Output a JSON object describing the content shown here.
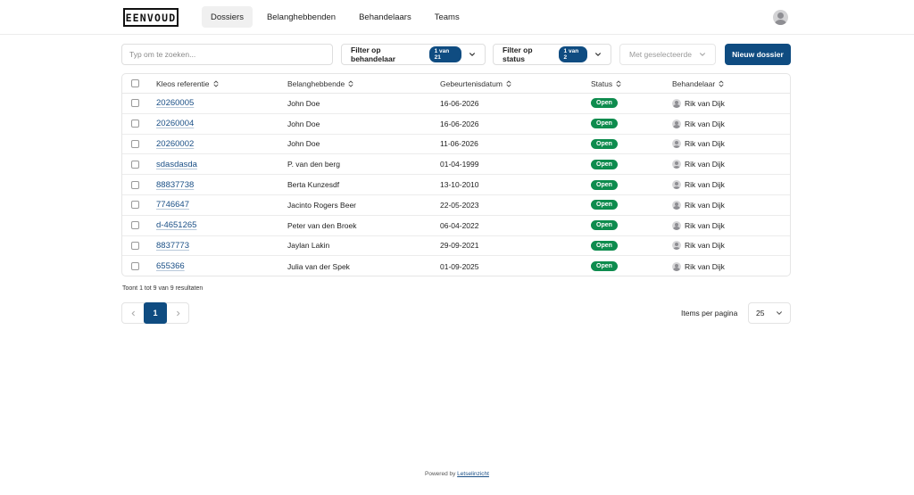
{
  "header": {
    "logo": "EENVOUD",
    "nav": [
      "Dossiers",
      "Belanghebbenden",
      "Behandelaars",
      "Teams"
    ],
    "active_nav": "Dossiers"
  },
  "toolbar": {
    "search_placeholder": "Typ om te zoeken...",
    "filter_behandelaar": {
      "label": "Filter op behandelaar",
      "badge": "1 van 21"
    },
    "filter_status": {
      "label": "Filter op status",
      "badge": "1 van 2"
    },
    "bulk_label": "Met geselecteerde",
    "new_label": "Nieuw dossier"
  },
  "table": {
    "columns": [
      "Kleos referentie",
      "Belanghebbende",
      "Gebeurtenisdatum",
      "Status",
      "Behandelaar"
    ],
    "rows": [
      {
        "ref": "20260005",
        "belanghebbende": "John Doe",
        "datum": "16-06-2026",
        "status": "Open",
        "behandelaar": "Rik van Dijk"
      },
      {
        "ref": "20260004",
        "belanghebbende": "John Doe",
        "datum": "16-06-2026",
        "status": "Open",
        "behandelaar": "Rik van Dijk"
      },
      {
        "ref": "20260002",
        "belanghebbende": "John Doe",
        "datum": "11-06-2026",
        "status": "Open",
        "behandelaar": "Rik van Dijk"
      },
      {
        "ref": "sdasdasda",
        "belanghebbende": "P. van den berg",
        "datum": "01-04-1999",
        "status": "Open",
        "behandelaar": "Rik van Dijk"
      },
      {
        "ref": "88837738",
        "belanghebbende": "Berta Kunzesdf",
        "datum": "13-10-2010",
        "status": "Open",
        "behandelaar": "Rik van Dijk"
      },
      {
        "ref": "7746647",
        "belanghebbende": "Jacinto Rogers Beer",
        "datum": "22-05-2023",
        "status": "Open",
        "behandelaar": "Rik van Dijk"
      },
      {
        "ref": "d-4651265",
        "belanghebbende": "Peter van den Broek",
        "datum": "06-04-2022",
        "status": "Open",
        "behandelaar": "Rik van Dijk"
      },
      {
        "ref": "8837773",
        "belanghebbende": "Jaylan Lakin",
        "datum": "29-09-2021",
        "status": "Open",
        "behandelaar": "Rik van Dijk"
      },
      {
        "ref": "655366",
        "belanghebbende": "Julia van der Spek",
        "datum": "01-09-2025",
        "status": "Open",
        "behandelaar": "Rik van Dijk"
      }
    ]
  },
  "pagination": {
    "results_text": "Toont 1 tot 9 van 9 resultaten",
    "current_page": "1",
    "items_per_page_label": "Items per pagina",
    "items_per_page_value": "25"
  },
  "footer": {
    "powered_prefix": "Powered by",
    "powered_link": "Letselinzicht"
  },
  "colors": {
    "primary": "#0f4c81",
    "status_open": "#0e8c4e",
    "link": "#1a4f86"
  }
}
